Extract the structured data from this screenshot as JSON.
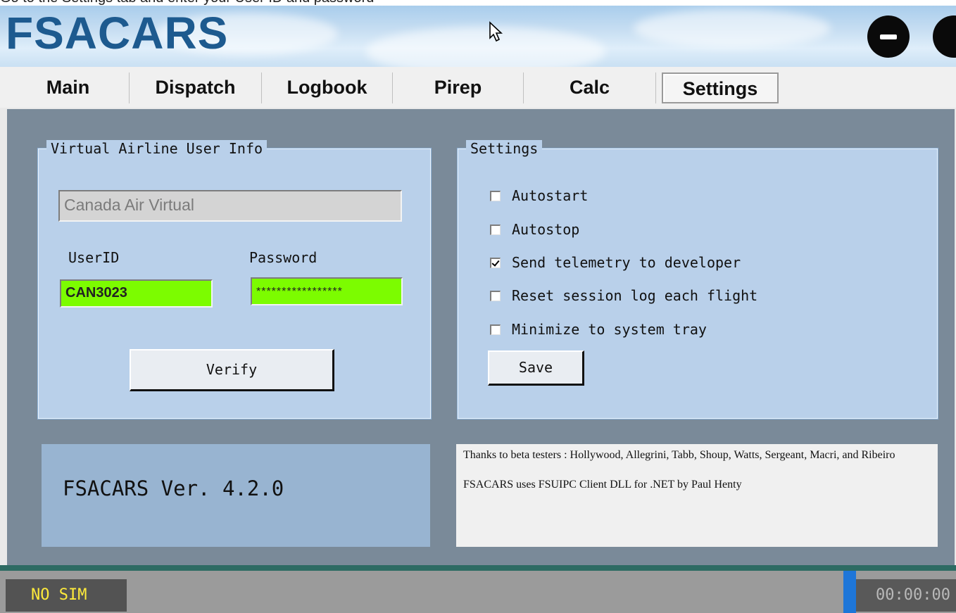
{
  "top_strip": {
    "text": "Go to the Settings tab and enter your User ID and password"
  },
  "app": {
    "logo": "FSACARS"
  },
  "window_controls": {
    "minimize_icon": "minimize-icon",
    "close_icon": "close-icon"
  },
  "tabs": [
    {
      "label": "Main"
    },
    {
      "label": "Dispatch"
    },
    {
      "label": "Logbook"
    },
    {
      "label": "Pirep"
    },
    {
      "label": "Calc"
    },
    {
      "label": "Settings",
      "active": true
    }
  ],
  "user_info": {
    "title": "Virtual Airline User Info",
    "airline_value": "Canada Air Virtual",
    "userid_label": "UserID",
    "userid_value": "CAN3023",
    "password_label": "Password",
    "password_value": "*****************",
    "verify_label": "Verify"
  },
  "settings": {
    "title": "Settings",
    "options": [
      {
        "label": "Autostart",
        "checked": false
      },
      {
        "label": "Autostop",
        "checked": false
      },
      {
        "label": "Send telemetry to developer",
        "checked": true
      },
      {
        "label": "Reset session log each flight",
        "checked": false
      },
      {
        "label": "Minimize to system tray",
        "checked": false
      }
    ],
    "save_label": "Save"
  },
  "version": {
    "text": "FSACARS Ver. 4.2.0"
  },
  "credits": {
    "line1": "Thanks to beta testers : Hollywood, Allegrini, Tabb, Shoup, Watts, Sergeant, Macri, and Ribeiro",
    "line2": "FSACARS uses FSUIPC Client DLL for .NET by Paul Henty"
  },
  "status": {
    "sim": "NO SIM",
    "timer": "00:00:00"
  },
  "colors": {
    "logo": "#1d5a8f",
    "panel": "#b9d0ea",
    "client_bg": "#7a8a99",
    "field_green": "#7cfc00",
    "status_yellow": "#ffeb3b",
    "accent_blue": "#1e76d8"
  }
}
